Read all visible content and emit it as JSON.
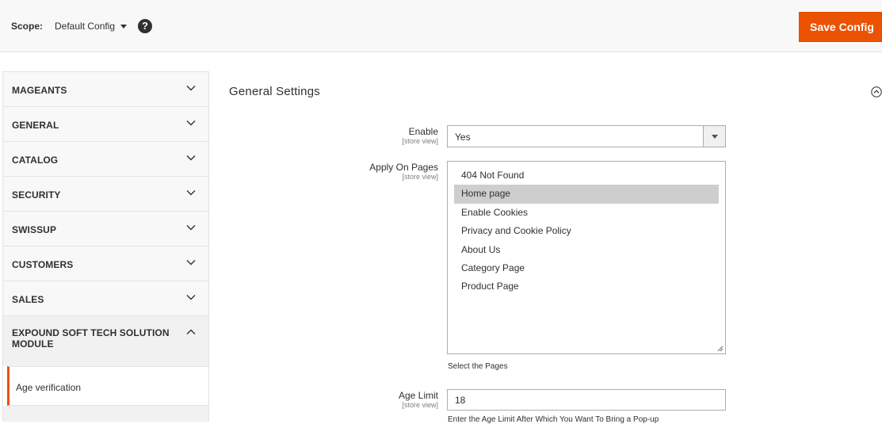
{
  "header": {
    "scope_label": "Scope:",
    "scope_value": "Default Config",
    "help_glyph": "?",
    "save_label": "Save Config",
    "accent_color": "#eb5202"
  },
  "sidebar": {
    "items": [
      {
        "label": "MAGEANTS"
      },
      {
        "label": "GENERAL"
      },
      {
        "label": "CATALOG"
      },
      {
        "label": "SECURITY"
      },
      {
        "label": "SWISSUP"
      },
      {
        "label": "CUSTOMERS"
      },
      {
        "label": "SALES"
      }
    ],
    "expanded": {
      "label": "EXPOUND SOFT TECH SOLUTION MODULE",
      "children": [
        {
          "label": "Age verification",
          "active": true
        }
      ]
    }
  },
  "main": {
    "section_title": "General Settings",
    "fields": {
      "enable": {
        "label": "Enable",
        "scope": "[store view]",
        "value": "Yes"
      },
      "apply_on_pages": {
        "label": "Apply On Pages",
        "scope": "[store view]",
        "options": [
          {
            "label": "404 Not Found",
            "selected": false
          },
          {
            "label": "Home page",
            "selected": true
          },
          {
            "label": "Enable Cookies",
            "selected": false
          },
          {
            "label": "Privacy and Cookie Policy",
            "selected": false
          },
          {
            "label": "About Us",
            "selected": false
          },
          {
            "label": "Category Page",
            "selected": false
          },
          {
            "label": "Product Page",
            "selected": false
          }
        ],
        "note": "Select the Pages"
      },
      "age_limit": {
        "label": "Age Limit",
        "scope": "[store view]",
        "value": "18",
        "note": "Enter the Age Limit After Which You Want To Bring a Pop-up"
      }
    }
  }
}
